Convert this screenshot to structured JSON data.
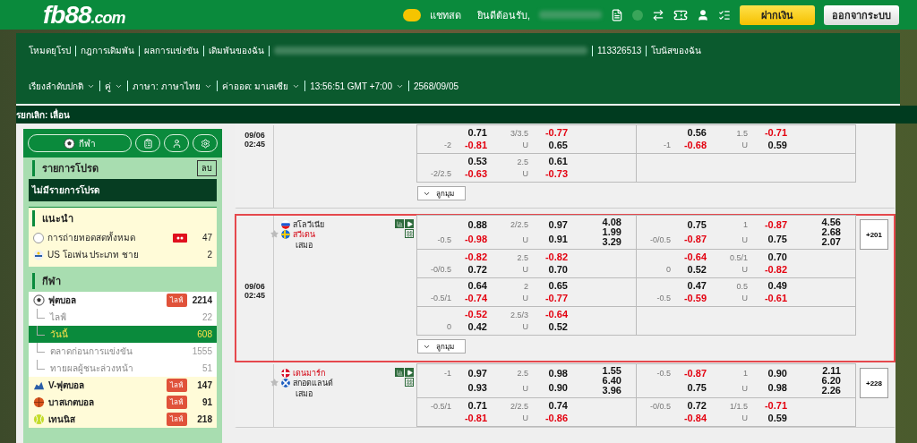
{
  "header": {
    "logo_main": "fb88",
    "logo_suffix": ".com",
    "chat_label": "แชทสด",
    "welcome": "ยินดีต้อนรับ,",
    "deposit_button": "ฝากเงิน",
    "logout_button": "ออกจากระบบ"
  },
  "nav_links": [
    "โหมดยุโรป",
    "กฎการเดิมพัน",
    "ผลการแข่งขัน",
    "เดิมพันของฉัน",
    "113326513",
    "โบนัสของฉัน"
  ],
  "settings": [
    {
      "label": "เรียงลำดับปกติ",
      "dropdown": true
    },
    {
      "label": "คู่",
      "dropdown": true
    },
    {
      "label": "ภาษา: ภาษาไทย",
      "dropdown": true
    },
    {
      "label": "ค่าออด: มาเลเซีย",
      "dropdown": true
    },
    {
      "label": "13:56:51 GMT +7:00",
      "dropdown": true
    },
    {
      "label": "2568/09/05",
      "dropdown": false
    }
  ],
  "notice": "รยกเลิก: เลื่อน",
  "sidebar": {
    "sports_button": "กีฬา",
    "favorites": {
      "title": "รายการโปรด",
      "clear_button": "ลบ",
      "empty_text": "ไม่มีรายการโปรด"
    },
    "recommended": {
      "title": "แนะนำ",
      "items": [
        {
          "label": "การถ่ายทอดสดทั้งหมด",
          "live_badge": true,
          "count": "47"
        },
        {
          "label": "US โอเพ่น ประเภท ชาย",
          "live_badge": false,
          "count": "2"
        }
      ]
    },
    "sports": {
      "title": "กีฬา",
      "items": [
        {
          "label": "ฟุตบอล",
          "badge": "ไลฟ์",
          "count": "2214",
          "expanded": true,
          "children": [
            {
              "label": "ไลฟ์",
              "count": "22",
              "selected": false
            },
            {
              "label": "วันนี้",
              "count": "608",
              "selected": true
            },
            {
              "label": "ตลาดก่อนการแข่งขัน",
              "count": "1555",
              "selected": false
            },
            {
              "label": "ทายผลผู้ชนะล่วงหน้า",
              "count": "51",
              "selected": false
            }
          ]
        },
        {
          "label": "V-ฟุตบอล",
          "badge": "ไลฟ์",
          "count": "147",
          "expanded": false
        },
        {
          "label": "บาสเกตบอล",
          "badge": "ไลฟ์",
          "count": "91",
          "expanded": false
        },
        {
          "label": "เทนนิส",
          "badge": "ไลฟ์",
          "count": "218",
          "expanded": false
        }
      ]
    }
  },
  "matches": [
    {
      "date": "09/06",
      "time": "02:45",
      "highlighted": false,
      "corner_button": "ลูกมุม",
      "rows": [
        {
          "ft": {
            "hdp_away": "-2",
            "home": "0.71",
            "away": "-0.81",
            "ou": "3/3.5",
            "under_label": "U",
            "over": "-0.77",
            "under": "0.65"
          },
          "fh": {
            "hdp_away": "-1",
            "home": "0.56",
            "away": "-0.68",
            "ou": "1.5",
            "under_label": "U",
            "over": "-0.71",
            "under": "0.59"
          }
        },
        {
          "ft": {
            "hdp_away": "-2/2.5",
            "home": "0.53",
            "away": "-0.63",
            "ou": "2.5",
            "under_label": "U",
            "over": "0.61",
            "under": "-0.73"
          }
        }
      ]
    },
    {
      "date": "09/06",
      "time": "02:45",
      "highlighted": true,
      "teams": [
        {
          "name": "สโลวีเนีย",
          "favorite": false
        },
        {
          "name": "สวีเดน",
          "favorite": true
        }
      ],
      "draw_label": "เสมอ",
      "more_markets": "+201",
      "corner_button": "ลูกมุม",
      "rows": [
        {
          "ft": {
            "hdp_away": "-0.5",
            "home": "0.88",
            "away": "-0.98",
            "ou": "2/2.5",
            "under_label": "U",
            "over": "0.97",
            "under": "0.91",
            "x12": [
              "4.08",
              "1.99",
              "3.29"
            ]
          },
          "fh": {
            "hdp_away": "-0/0.5",
            "home": "0.75",
            "away": "-0.87",
            "ou": "1",
            "under_label": "U",
            "over": "-0.87",
            "under": "0.75",
            "x12": [
              "4.56",
              "2.68",
              "2.07"
            ]
          }
        },
        {
          "ft": {
            "hdp_away": "-0/0.5",
            "home": "-0.82",
            "away": "0.72",
            "ou": "2.5",
            "under_label": "U",
            "over": "-0.82",
            "under": "0.70"
          },
          "fh": {
            "hdp_away": "0",
            "home": "-0.64",
            "away": "0.52",
            "ou": "0.5/1",
            "under_label": "U",
            "over": "0.70",
            "under": "-0.82"
          }
        },
        {
          "ft": {
            "hdp_away": "-0.5/1",
            "home": "0.64",
            "away": "-0.74",
            "ou": "2",
            "under_label": "U",
            "over": "0.65",
            "under": "-0.77"
          },
          "fh": {
            "hdp_away": "-0.5",
            "home": "0.47",
            "away": "-0.59",
            "ou": "0.5",
            "under_label": "U",
            "over": "0.49",
            "under": "-0.61"
          }
        },
        {
          "ft": {
            "hdp_away": "0",
            "home": "-0.52",
            "away": "0.42",
            "ou": "2.5/3",
            "under_label": "U",
            "over": "-0.64",
            "under": "0.52"
          }
        }
      ]
    },
    {
      "highlighted": false,
      "teams": [
        {
          "name": "เดนมาร์ก",
          "favorite": true
        },
        {
          "name": "สกอตแลนด์",
          "favorite": false
        }
      ],
      "draw_label": "เสมอ",
      "more_markets": "+228",
      "rows": [
        {
          "ft": {
            "hdp_home": "-1",
            "home": "0.97",
            "away": "0.93",
            "ou": "2.5",
            "under_label": "U",
            "over": "0.98",
            "under": "0.90",
            "x12": [
              "1.55",
              "6.40",
              "3.96"
            ]
          },
          "fh": {
            "hdp_home": "-0.5",
            "home": "-0.87",
            "away": "0.75",
            "ou": "1",
            "under_label": "U",
            "over": "0.90",
            "under": "0.98",
            "x12": [
              "2.11",
              "6.20",
              "2.26"
            ]
          }
        },
        {
          "ft": {
            "hdp_home": "-0.5/1",
            "home": "0.71",
            "away": "-0.81",
            "ou": "2/2.5",
            "under_label": "U",
            "over": "0.74",
            "under": "-0.86"
          },
          "fh": {
            "hdp_home": "-0/0.5",
            "home": "0.72",
            "away": "-0.84",
            "ou": "1/1.5",
            "under_label": "U",
            "over": "-0.71",
            "under": "0.59"
          }
        }
      ]
    }
  ]
}
